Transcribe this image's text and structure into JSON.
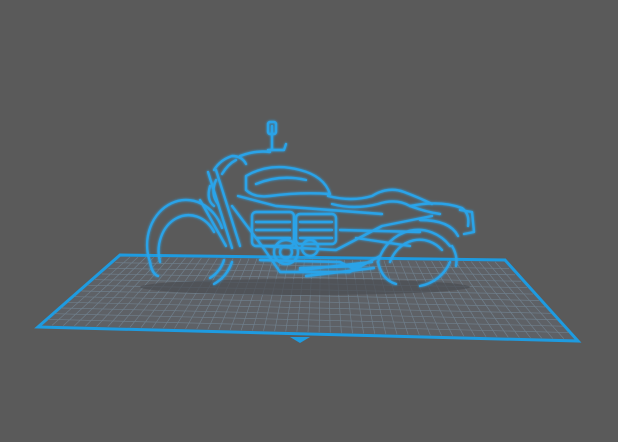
{
  "viewport": {
    "background": "#5a5a5a"
  },
  "build_plate": {
    "grid_color": "#6f7f8c",
    "edge_color": "#1e9be0",
    "origin_marker": "triangle-marker"
  },
  "model": {
    "subject": "motorcycle-wireframe",
    "stroke_color": "#2aa3e8",
    "glow_color": "#7fd0ff",
    "shadow_color": "#3e3e3e"
  }
}
